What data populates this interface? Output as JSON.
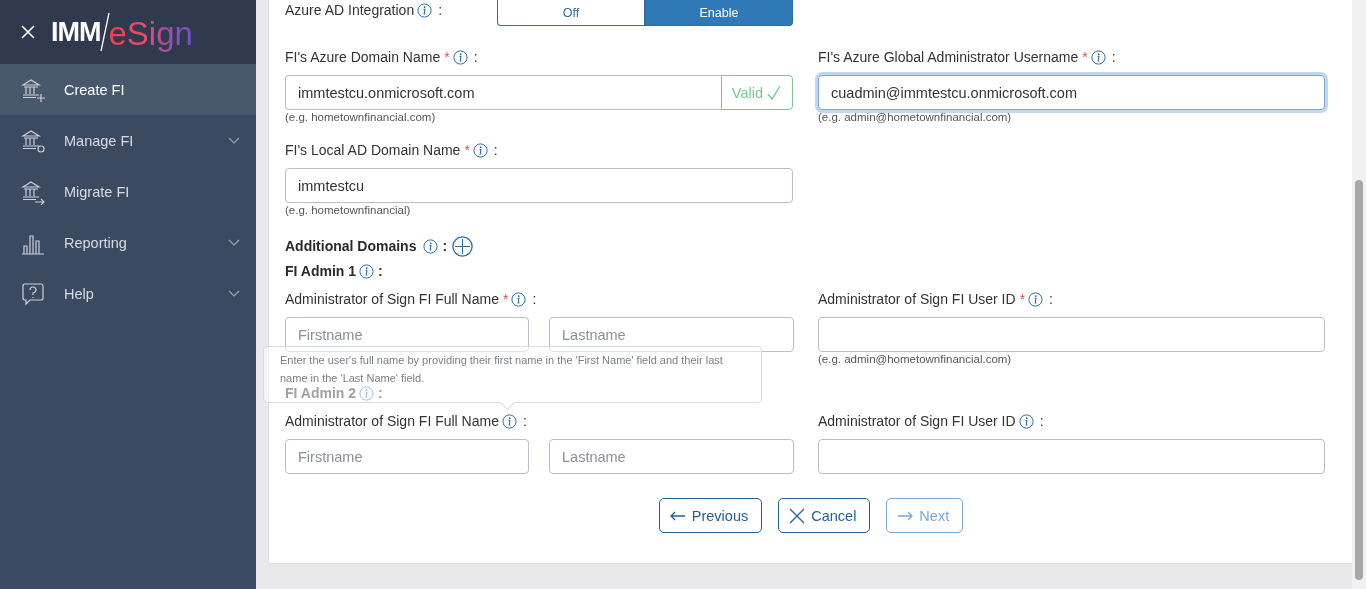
{
  "sidebar": {
    "logo": {
      "left": "IMM",
      "right": "eSign"
    },
    "items": [
      {
        "label": "Create FI",
        "kind": "create",
        "selected": true,
        "expandable": false
      },
      {
        "label": "Manage FI",
        "kind": "manage",
        "selected": false,
        "expandable": true
      },
      {
        "label": "Migrate FI",
        "kind": "migrate",
        "selected": false,
        "expandable": false
      },
      {
        "label": "Reporting",
        "kind": "reporting",
        "selected": false,
        "expandable": true
      },
      {
        "label": "Help",
        "kind": "help",
        "selected": false,
        "expandable": true
      }
    ]
  },
  "azure_ad_integration": {
    "label": "Azure AD Integration",
    "colon": ":",
    "options": [
      {
        "label": "Off",
        "selected": false
      },
      {
        "label": "Enable",
        "selected": true
      }
    ]
  },
  "domain_fields": [
    {
      "label": "FI's Azure Domain Name",
      "required_mark": "*",
      "colon": ":",
      "value": "immtestcu.onmicrosoft.com",
      "status": "Valid",
      "hint": "(e.g. hometownfinancial.com)",
      "focused": false
    },
    {
      "label": "FI's Azure Global Administrator Username",
      "required_mark": "*",
      "colon": ":",
      "value": "cuadmin@immtestcu.onmicrosoft.com",
      "hint": "(e.g. admin@hometownfinancial.com)",
      "focused": true
    },
    {
      "label": "FI's Local AD Domain Name",
      "required_mark": "*",
      "colon": ":",
      "value": "immtestcu",
      "hint": "(e.g. hometownfinancial)",
      "focused": false
    }
  ],
  "additional_domains": {
    "label": "Additional Domains",
    "colon": ":"
  },
  "admins": [
    {
      "title": "FI Admin 1",
      "colon": ":",
      "full_name": {
        "label": "Administrator of Sign FI Full Name",
        "required_mark": "*",
        "colon": ":",
        "first_placeholder": "Firstname",
        "last_placeholder": "Lastname"
      },
      "user_id": {
        "label": "Administrator of Sign FI User ID",
        "required_mark": "*",
        "colon": ":",
        "hint": "(e.g. admin@hometownfinancial.com)"
      }
    },
    {
      "title": "FI Admin 2",
      "colon": ":",
      "full_name": {
        "label": "Administrator of Sign FI Full Name",
        "colon": ":",
        "first_placeholder": "Firstname",
        "last_placeholder": "Lastname"
      },
      "user_id": {
        "label": "Administrator of Sign FI User ID",
        "colon": ":"
      }
    }
  ],
  "tooltip": {
    "text": "Enter the user's full name by providing their first name in the 'First Name' field and their last name in the 'Last Name' field."
  },
  "buttons": [
    {
      "label": "Previous",
      "kind": "previous",
      "disabled": false
    },
    {
      "label": "Cancel",
      "kind": "cancel",
      "disabled": false
    },
    {
      "label": "Next",
      "kind": "next",
      "disabled": true
    }
  ]
}
